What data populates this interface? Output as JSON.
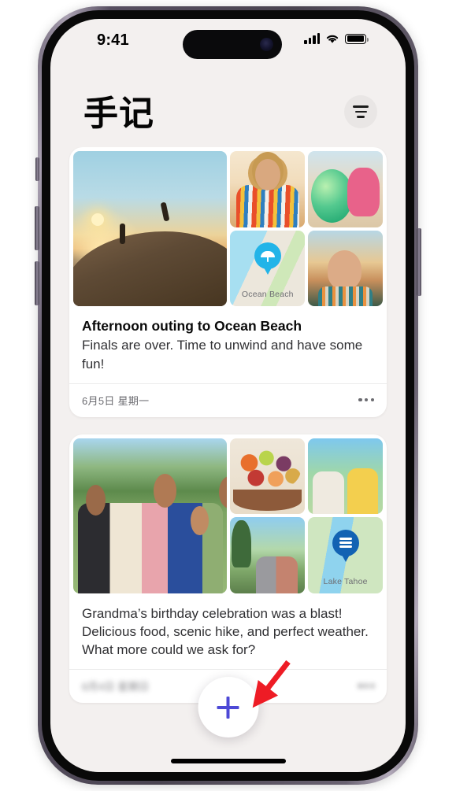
{
  "status_bar": {
    "time": "9:41",
    "signal_icon": "cellular-signal-icon",
    "wifi_icon": "wifi-icon",
    "battery_icon": "battery-full-icon"
  },
  "header": {
    "title": "手记",
    "filter_icon": "filter-lines-icon"
  },
  "feed": {
    "entries": [
      {
        "title": "Afternoon outing to Ocean Beach",
        "text": "Finals are over. Time to unwind and have some fun!",
        "date": "6月5日 星期一",
        "more_icon": "ellipsis-icon",
        "photos": [
          {
            "name": "sunset-cliff-jumpers-photo",
            "style": "ph-sunset-cliff"
          },
          {
            "name": "woman-striped-shirt-photo",
            "style": "ph-portrait-stripes"
          },
          {
            "name": "woman-green-beachball-photo",
            "style": "ph-beachball"
          },
          {
            "name": "ocean-beach-map-tile",
            "style": "ph-map-ocean",
            "map_label": "Ocean Beach",
            "pin_icon": "beach-umbrella-pin-icon"
          },
          {
            "name": "woman-sunset-portrait-photo",
            "style": "ph-sunset-portrait"
          }
        ]
      },
      {
        "title": "",
        "text": "Grandma’s birthday celebration was a blast! Delicious food, scenic hike, and perfect weather. What more could we ask for?",
        "date": "6月4日 星期日",
        "more_icon": "ellipsis-icon",
        "photos": [
          {
            "name": "family-group-photo",
            "style": "ph-family"
          },
          {
            "name": "fruit-bowl-photo",
            "style": "ph-fruit"
          },
          {
            "name": "mother-and-child-photo",
            "style": "ph-pair-yellow"
          },
          {
            "name": "two-hikers-photo",
            "style": "ph-hikers"
          },
          {
            "name": "lake-tahoe-map-tile",
            "style": "ph-map-lake",
            "map_label": "Lake Tahoe",
            "pin_icon": "water-waves-pin-icon"
          }
        ]
      }
    ]
  },
  "fab": {
    "name": "add-entry-button",
    "icon": "plus-icon"
  },
  "annotation": {
    "arrow_color": "#ee1c25",
    "arrow_name": "pointer-arrow-to-add-button"
  },
  "colors": {
    "background": "#f3f0ef",
    "card": "#ffffff",
    "accent_plus": "#4d49d6",
    "ocean_pin": "#22b4e8",
    "lake_pin": "#1262b3",
    "text_primary": "#0a0a0a",
    "text_secondary": "#6b6b70"
  }
}
